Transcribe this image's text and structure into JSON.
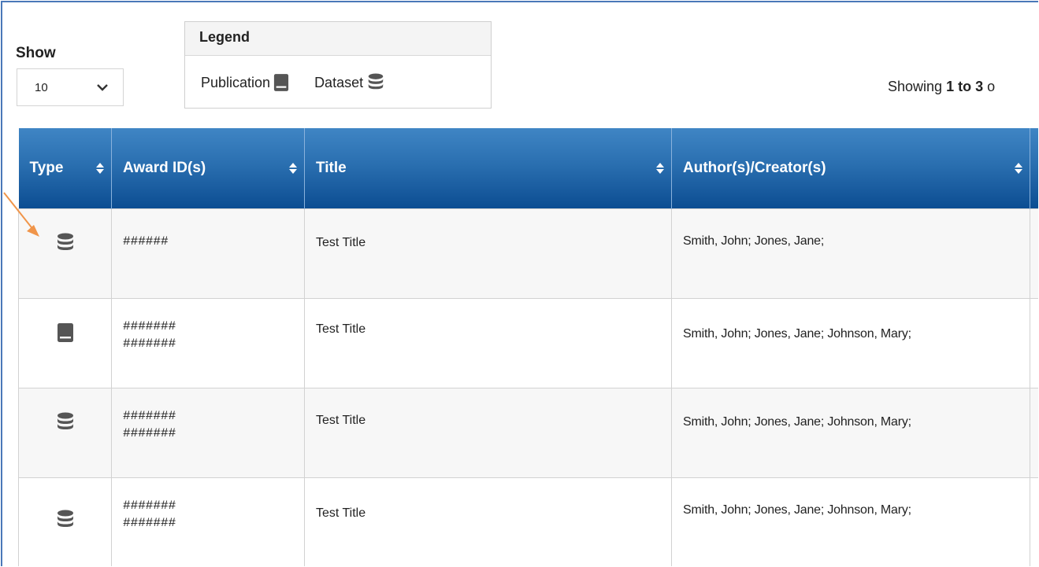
{
  "controls": {
    "show_label": "Show",
    "page_size": "10",
    "legend_title": "Legend",
    "legend_items": [
      {
        "label": "Publication",
        "icon": "book-icon"
      },
      {
        "label": "Dataset",
        "icon": "database-icon"
      }
    ],
    "showing_prefix": "Showing ",
    "showing_range": "1 to 3",
    "showing_suffix": " o"
  },
  "table": {
    "columns": [
      "Type",
      "Award ID(s)",
      "Title",
      "Author(s)/Creator(s)"
    ],
    "rows": [
      {
        "type": "database-icon",
        "award_ids": [
          "######"
        ],
        "title": "Test Title",
        "authors": "Smith, John;  Jones, Jane;"
      },
      {
        "type": "book-icon",
        "award_ids": [
          "#######",
          "#######"
        ],
        "title": "Test Title",
        "authors": "Smith, John;  Jones, Jane; Johnson, Mary;"
      },
      {
        "type": "database-icon",
        "award_ids": [
          "#######",
          "#######"
        ],
        "title": "Test Title",
        "authors": "Smith, John;  Jones, Jane; Johnson, Mary;"
      },
      {
        "type": "database-icon",
        "award_ids": [
          "#######",
          "#######"
        ],
        "title": "Test Title",
        "authors": "Smith, John;  Jones, Jane; Johnson, Mary;"
      }
    ]
  },
  "colors": {
    "header_top": "#3f85c4",
    "header_bottom": "#0c4d92",
    "arrow": "#f0954a",
    "frame_border": "#4a78b8"
  }
}
